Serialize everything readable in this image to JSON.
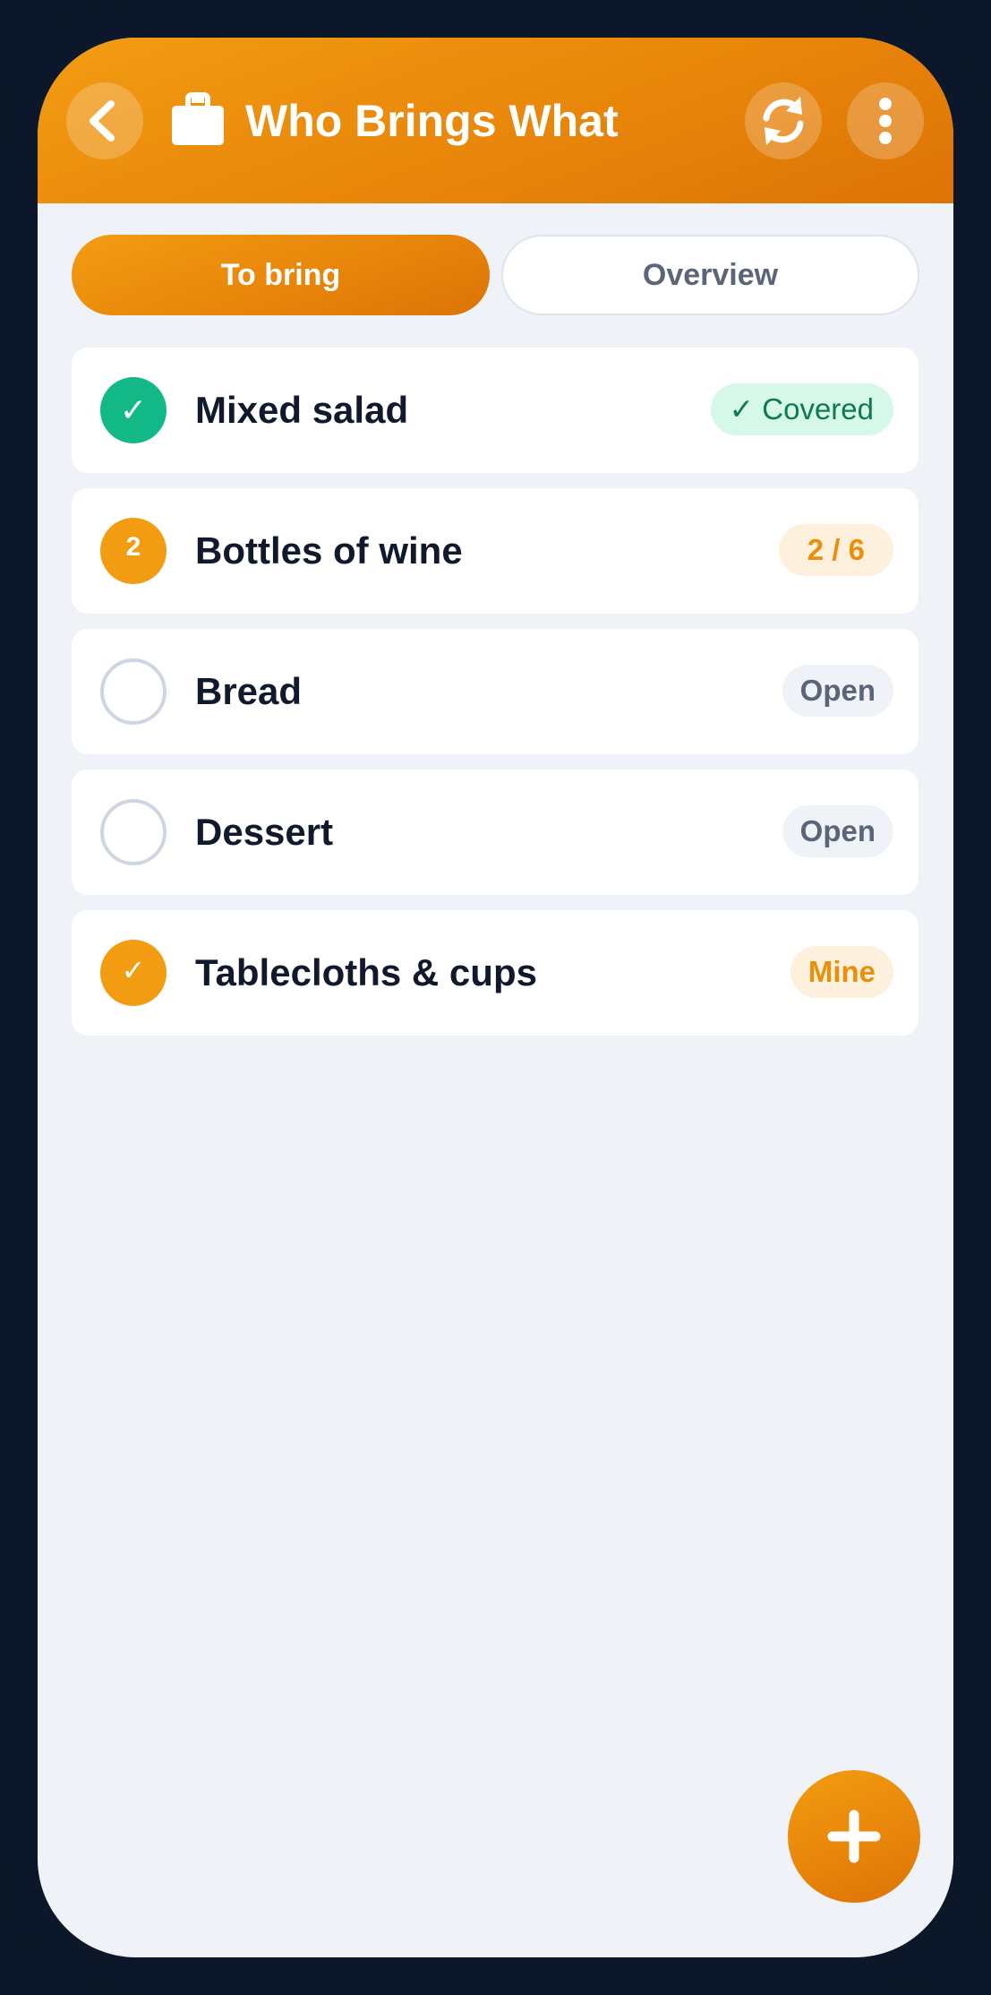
{
  "header": {
    "title": "Who Brings What",
    "back_icon": "chevron-left-icon",
    "app_icon": "shopping-bag-icon",
    "refresh_icon": "refresh-icon",
    "more_icon": "more-vertical-icon"
  },
  "tabs": [
    {
      "label": "To bring",
      "active": true
    },
    {
      "label": "Overview",
      "active": false
    }
  ],
  "items": [
    {
      "name": "Mixed salad",
      "status_glyph": "✓",
      "badge": "✓ Covered",
      "state": "covered"
    },
    {
      "name": "Bottles of wine",
      "status_glyph": "2",
      "badge": "2 / 6",
      "state": "partial",
      "brought": 2,
      "needed": 6
    },
    {
      "name": "Bread",
      "status_glyph": "",
      "badge": "Open",
      "state": "open"
    },
    {
      "name": "Dessert",
      "status_glyph": "",
      "badge": "Open",
      "state": "open"
    },
    {
      "name": "Tablecloths & cups",
      "status_glyph": "✓",
      "badge": "Mine",
      "state": "mine"
    }
  ],
  "fab": {
    "icon": "plus-icon"
  },
  "colors": {
    "accent": "#f29c12",
    "accent_dark": "#dd7406",
    "covered": "#12b886",
    "text": "#111a2c",
    "muted": "#5b6577",
    "background": "#eff2f7"
  }
}
